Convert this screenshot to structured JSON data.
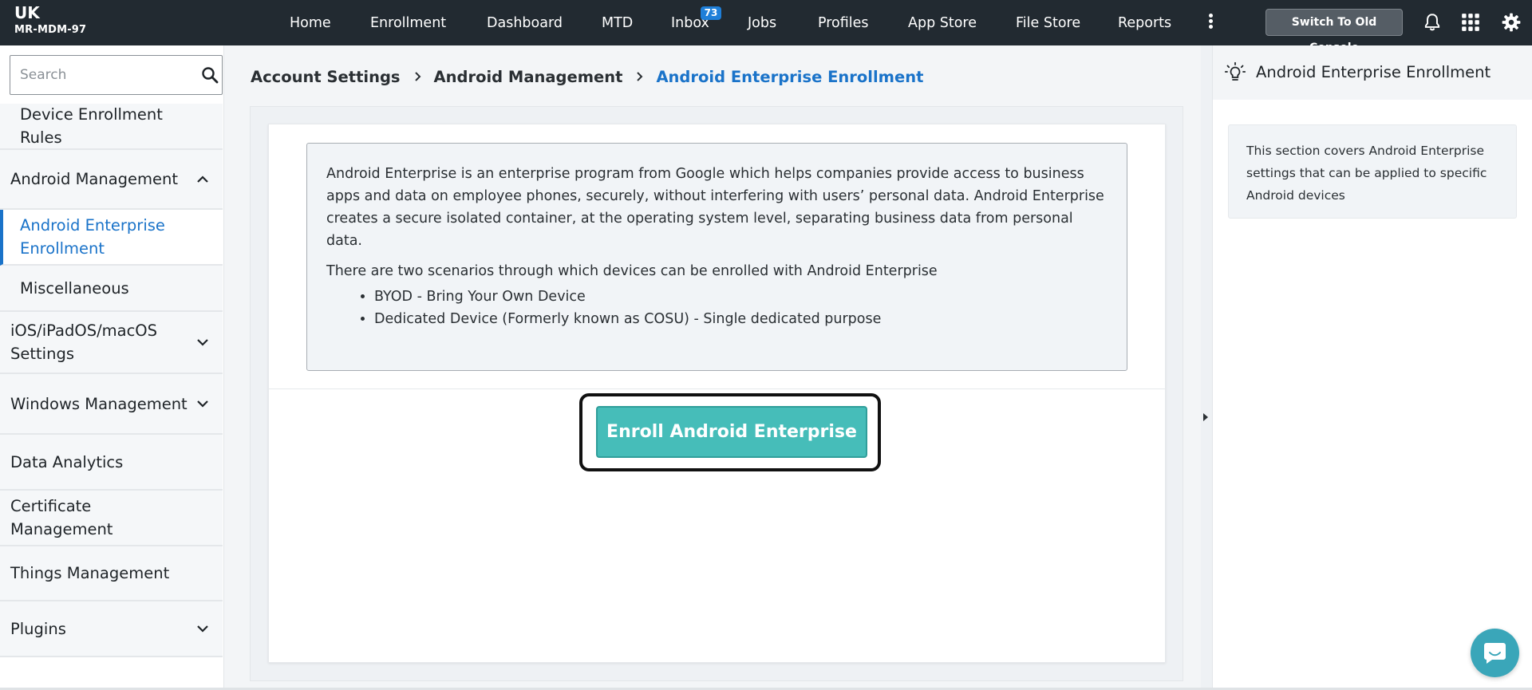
{
  "org": {
    "name": "UK",
    "id": "MR-MDM-97"
  },
  "nav": {
    "items": [
      {
        "label": "Home"
      },
      {
        "label": "Enrollment"
      },
      {
        "label": "Dashboard"
      },
      {
        "label": "MTD"
      },
      {
        "label": "Inbox",
        "badge": "73"
      },
      {
        "label": "Jobs"
      },
      {
        "label": "Profiles"
      },
      {
        "label": "App Store"
      },
      {
        "label": "File Store"
      },
      {
        "label": "Reports"
      }
    ],
    "more_icon": "kebab-vertical-icon",
    "switch_label": "Switch To Old Console",
    "icons": [
      "bell-icon",
      "apps-grid-icon",
      "gear-icon"
    ]
  },
  "sidebar": {
    "search_placeholder": "Search",
    "items": [
      {
        "label": "Device Enrollment Rules",
        "type": "sub"
      },
      {
        "label": "Android Management",
        "type": "group",
        "expanded": true
      },
      {
        "label": "Android Enterprise Enrollment",
        "type": "sub",
        "active": true
      },
      {
        "label": "Miscellaneous",
        "type": "sub"
      },
      {
        "label": "iOS/iPadOS/macOS Settings",
        "type": "group",
        "expanded": false
      },
      {
        "label": "Windows Management",
        "type": "group",
        "expanded": false
      },
      {
        "label": "Data Analytics",
        "type": "item"
      },
      {
        "label": "Certificate Management",
        "type": "item"
      },
      {
        "label": "Things Management",
        "type": "item"
      },
      {
        "label": "Plugins",
        "type": "group",
        "expanded": false
      }
    ]
  },
  "breadcrumb": [
    "Account Settings",
    "Android Management",
    "Android Enterprise Enrollment"
  ],
  "main": {
    "intro": "Android Enterprise is an enterprise program from Google which helps companies provide access to business apps and data on employee phones, securely, without interfering with users’ personal data. Android Enterprise creates a secure isolated container, at the operating system level, separating business data from personal data.",
    "scenarios_intro": "There are two scenarios through which devices can be enrolled with Android Enterprise",
    "scenarios": [
      "BYOD - Bring Your Own Device",
      "Dedicated Device (Formerly known as COSU) - Single dedicated purpose"
    ],
    "enroll_button": "Enroll Android Enterprise"
  },
  "help": {
    "title": "Android Enterprise Enrollment",
    "text": "This section covers Android Enterprise settings that can be applied to specific Android devices"
  },
  "colors": {
    "topbar": "#222a31",
    "accent": "#1a73c9",
    "enroll_button": "#46bdb9",
    "badge": "#1f7fd9",
    "chat": "#3aa6b9"
  }
}
